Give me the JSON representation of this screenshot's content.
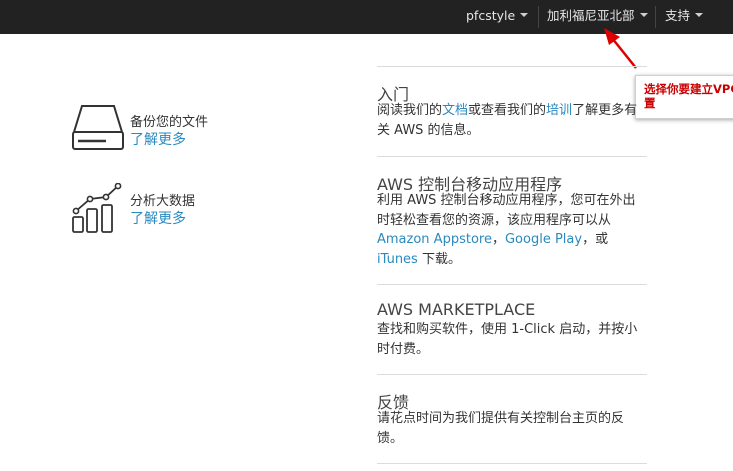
{
  "topbar": {
    "account": "pfcstyle",
    "region": "加利福尼亚北部",
    "support": "支持"
  },
  "callout": {
    "text": "选择你要建立VPC的位置"
  },
  "features": [
    {
      "title": "备份您的文件",
      "link": "了解更多",
      "icon": "hard-drive-icon"
    },
    {
      "title": "分析大数据",
      "link": "了解更多",
      "icon": "bar-chart-icon"
    }
  ],
  "sections": {
    "intro": {
      "title": "入门",
      "p1": "阅读我们的",
      "docs_link": "文档",
      "p2": "或查看我们的",
      "training_link": "培训",
      "p3": "了解更多有关 AWS 的信息。"
    },
    "mobile": {
      "title": "AWS 控制台移动应用程序",
      "p1": "利用 AWS 控制台移动应用程序，您可在外出时轻松查看您的资源，该应用程序可以从",
      "amazon_link": "Amazon Appstore",
      "sep": "，",
      "gplay_link": "Google Play",
      "or": "，或",
      "itunes_link": "iTunes",
      "p2": " 下载。"
    },
    "marketplace": {
      "title": "AWS MARKETPLACE",
      "body": "查找和购买软件，使用 1-Click 启动，并按小时付费。"
    },
    "feedback": {
      "title": "反馈",
      "body": "请花点时间为我们提供有关控制台主页的反馈。"
    }
  },
  "colors": {
    "topbar": "#222222",
    "link": "#2a8ac0",
    "callout_text": "#cc0000",
    "arrow": "#dd0000"
  }
}
